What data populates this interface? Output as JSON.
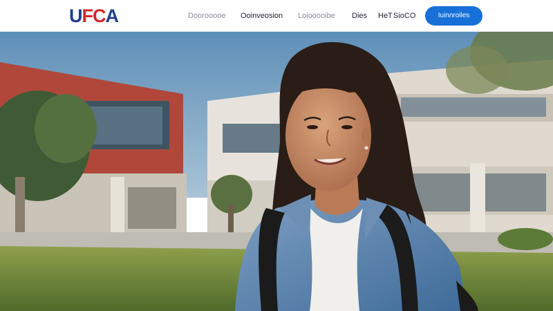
{
  "brand": {
    "logo_text_1": "U",
    "logo_text_2": "FC",
    "logo_text_3": "A",
    "primary_color": "#1f3f8f",
    "accent_color": "#d7252b"
  },
  "nav": {
    "items": [
      {
        "label": "Doorooooe"
      },
      {
        "label": "Ooinveosion"
      },
      {
        "label": "Loiooooibe"
      },
      {
        "label": "Dies"
      },
      {
        "label": "HeT"
      },
      {
        "label": "SioCO"
      }
    ],
    "cta_label": "Iuinnroiles",
    "cta_color": "#1670d8"
  },
  "hero": {
    "scene_icon": "campus-student-photo"
  }
}
